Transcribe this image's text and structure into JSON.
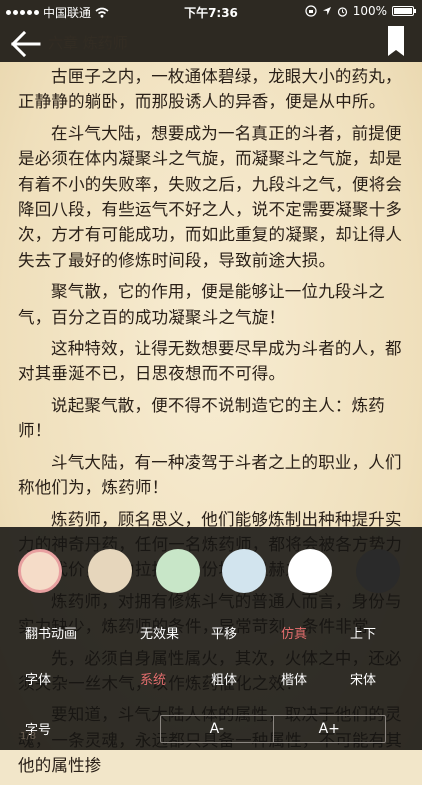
{
  "status_bar": {
    "carrier": "中国联通",
    "time": "下午7:36",
    "battery": "100%"
  },
  "nav": {
    "chapter_title": "六章 炼药师"
  },
  "content": {
    "paragraphs": [
      "古匣子之内，一枚通体碧绿，龙眼大小的药丸，正静静的躺卧，而那股诱人的异香，便是从中所。",
      "在斗气大陆，想要成为一名真正的斗者，前提便是必须在体内凝聚斗之气旋，而凝聚斗之气旋，却是有着不小的失败率，失败之后，九段斗之气，便将会降回八段，有些运气不好之人，说不定需要凝聚十多次，方才有可能成功，而如此重复的凝聚，却让得人失去了最好的修炼时间段，导致前途大损。",
      "聚气散，它的作用，便是能够让一位九段斗之气，百分之百的成功凝聚斗之气旋！",
      "这种特效，让得无数想要尽早成为斗者的人，都对其垂涎不已，日思夜想而不可得。",
      "说起聚气散，便不得不说制造它的主人：炼药师！",
      "斗气大陆，有一种凌驾于斗者之上的职业，人们称他们为，炼药师！",
      "炼药师，顾名思义，他们能够炼制出种种提升实力的神奇丹药，任何一名炼药师，都将会被各方势力不惜代价，竭力拉拢，身份地位显赫之极！",
      "炼药师，对拥有修炼斗气的普通人而言，身份与实力缺少，炼药师的条件，异常苛刻，条件非常。",
      "先，必须自身属性属火，其次，火体之中，还必须夹杂一丝木气，以作炼药催化之效！",
      "要知道，斗气大陆人体的属性，取决于他们的灵魂，一条灵魂，永远都只具备一种属性，不可能有其他的属性掺"
    ]
  },
  "panel": {
    "colors": [
      "#f5dcc8",
      "#e6d6bc",
      "#c8e6c8",
      "#d2e4ee",
      "#ffffff",
      "#2a2a2a"
    ],
    "selected_color_index": 0,
    "animation": {
      "label": "翻书动画",
      "options": [
        "无效果",
        "平移",
        "仿真",
        "上下"
      ],
      "active_index": 2
    },
    "font": {
      "label": "字体",
      "options": [
        "系统",
        "粗体",
        "楷体",
        "宋体"
      ],
      "active_index": 0
    },
    "size": {
      "label": "字号",
      "decrease": "A-",
      "increase": "A+"
    }
  },
  "page_number": "1/8"
}
